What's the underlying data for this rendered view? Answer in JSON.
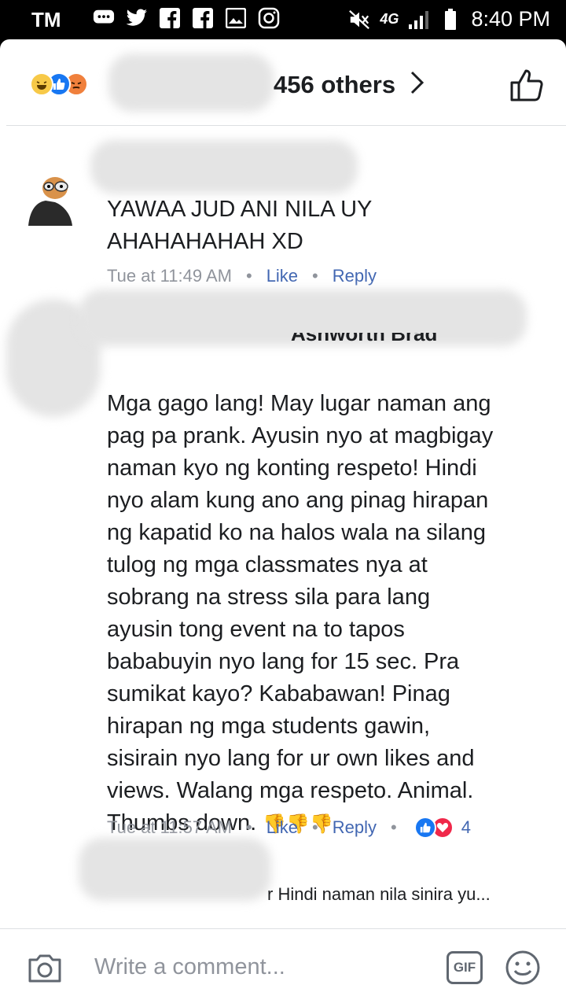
{
  "status_bar": {
    "carrier": "TM",
    "network": "4G",
    "time": "8:40 PM"
  },
  "reactions_bar": {
    "others_text": "456 others",
    "reaction_icons": [
      "haha-icon",
      "like-icon",
      "angry-icon"
    ]
  },
  "comments": [
    {
      "text": "YAWAA JUD ANI NILA UY\nAHAHAHAHAH XD",
      "time": "Tue at 11:49 AM",
      "like_label": "Like",
      "reply_label": "Reply"
    },
    {
      "name_fragment": "Ashworth Brad",
      "text": "Mga gago lang! May lugar naman ang\npag pa prank. Ayusin nyo at magbigay\nnaman kyo ng konting respeto! Hindi\nnyo alam kung ano ang pinag hirapan\nng kapatid ko na halos wala na silang\ntulog ng mga classmates  nya at\nsobrang na stress sila para lang\nayusin tong event na to tapos\nbababuyin nyo lang for 15 sec. Pra\nsumikat kayo? Kababawan! Pinag\nhirapan ng mga students gawin,\nsisirain nyo lang for ur own likes and\nviews. Walang mga respeto. Animal.\nThumbs down. ",
      "emoji": "👎👎👎",
      "time": "Tue at 11:57 AM",
      "like_label": "Like",
      "reply_label": "Reply",
      "reaction_count": "4"
    }
  ],
  "reply_preview": {
    "text": "r Hindi naman nila sinira yu..."
  },
  "composer": {
    "placeholder": "Write a comment...",
    "gif_label": "GIF"
  },
  "colors": {
    "link": "#4267b2",
    "meta": "#90949c",
    "like_blue": "#1877f2",
    "love_red": "#f0284a"
  }
}
